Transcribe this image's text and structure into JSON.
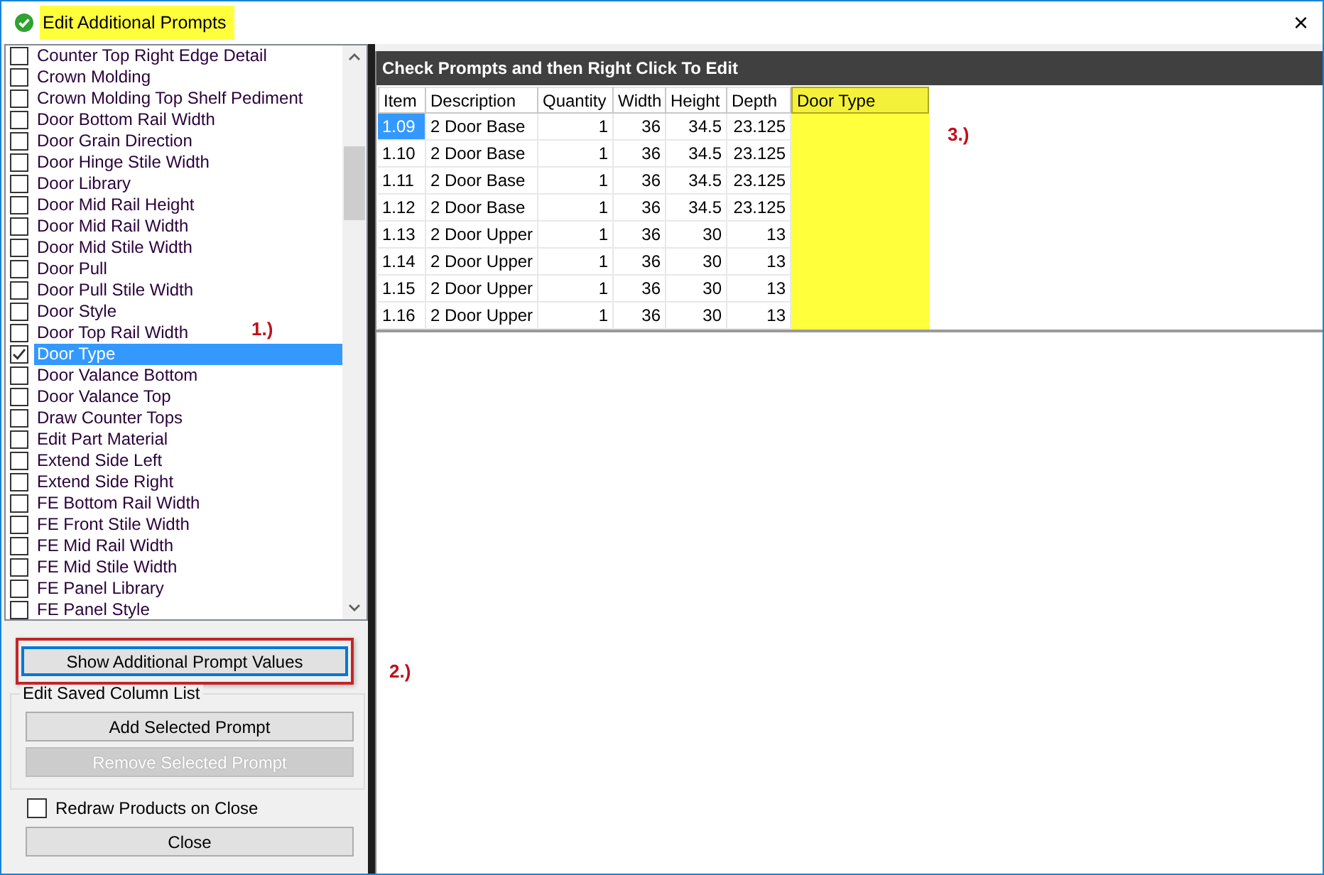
{
  "window": {
    "title": "Edit Additional Prompts",
    "title_highlighted": true,
    "close": "×"
  },
  "prompts": [
    {
      "label": "Counter Top Right Edge Detail",
      "checked": false,
      "selected": false
    },
    {
      "label": "Crown Molding",
      "checked": false,
      "selected": false
    },
    {
      "label": "Crown Molding Top Shelf Pediment",
      "checked": false,
      "selected": false
    },
    {
      "label": "Door Bottom Rail Width",
      "checked": false,
      "selected": false
    },
    {
      "label": "Door Grain Direction",
      "checked": false,
      "selected": false
    },
    {
      "label": "Door Hinge Stile Width",
      "checked": false,
      "selected": false
    },
    {
      "label": "Door Library",
      "checked": false,
      "selected": false
    },
    {
      "label": "Door Mid Rail Height",
      "checked": false,
      "selected": false
    },
    {
      "label": "Door Mid Rail Width",
      "checked": false,
      "selected": false
    },
    {
      "label": "Door Mid Stile Width",
      "checked": false,
      "selected": false
    },
    {
      "label": "Door Pull",
      "checked": false,
      "selected": false
    },
    {
      "label": "Door Pull Stile Width",
      "checked": false,
      "selected": false
    },
    {
      "label": "Door Style",
      "checked": false,
      "selected": false
    },
    {
      "label": "Door Top Rail Width",
      "checked": false,
      "selected": false
    },
    {
      "label": "Door Type",
      "checked": true,
      "selected": true
    },
    {
      "label": "Door Valance Bottom",
      "checked": false,
      "selected": false
    },
    {
      "label": "Door Valance Top",
      "checked": false,
      "selected": false
    },
    {
      "label": "Draw Counter Tops",
      "checked": false,
      "selected": false
    },
    {
      "label": "Edit Part Material",
      "checked": false,
      "selected": false
    },
    {
      "label": "Extend Side Left",
      "checked": false,
      "selected": false
    },
    {
      "label": "Extend Side Right",
      "checked": false,
      "selected": false
    },
    {
      "label": "FE Bottom Rail Width",
      "checked": false,
      "selected": false
    },
    {
      "label": "FE Front Stile Width",
      "checked": false,
      "selected": false
    },
    {
      "label": "FE Mid Rail Width",
      "checked": false,
      "selected": false
    },
    {
      "label": "FE Mid Stile Width",
      "checked": false,
      "selected": false
    },
    {
      "label": "FE Panel Library",
      "checked": false,
      "selected": false
    },
    {
      "label": "FE Panel Style",
      "checked": false,
      "selected": false
    }
  ],
  "show_button": {
    "label": "Show Additional Prompt Values",
    "outlined": true
  },
  "saved_columns": {
    "title": "Edit Saved Column List",
    "buttons": [
      {
        "label": "Add Selected Prompt",
        "disabled": false
      },
      {
        "label": "Remove Selected Prompt",
        "disabled": true
      }
    ]
  },
  "redraw": {
    "label": "Redraw Products on Close",
    "checked": false
  },
  "close_button": "Close",
  "panel_title": "Check Prompts and then Right Click To Edit",
  "table": {
    "columns": [
      {
        "label": "Item",
        "kind": "text",
        "highlighted": false
      },
      {
        "label": "Description",
        "kind": "text",
        "highlighted": false
      },
      {
        "label": "Quantity",
        "kind": "number",
        "highlighted": false
      },
      {
        "label": "Width",
        "kind": "number",
        "highlighted": false
      },
      {
        "label": "Height",
        "kind": "number",
        "highlighted": false
      },
      {
        "label": "Depth",
        "kind": "number",
        "highlighted": false
      },
      {
        "label": "Door Type",
        "kind": "text",
        "highlighted": true
      }
    ],
    "rows": [
      {
        "selected": true,
        "cells": [
          "1.09",
          "2 Door Base",
          "1",
          "36",
          "34.5",
          "23.125",
          ""
        ]
      },
      {
        "selected": false,
        "cells": [
          "1.10",
          "2 Door Base",
          "1",
          "36",
          "34.5",
          "23.125",
          ""
        ]
      },
      {
        "selected": false,
        "cells": [
          "1.11",
          "2 Door Base",
          "1",
          "36",
          "34.5",
          "23.125",
          ""
        ]
      },
      {
        "selected": false,
        "cells": [
          "1.12",
          "2 Door Base",
          "1",
          "36",
          "34.5",
          "23.125",
          ""
        ]
      },
      {
        "selected": false,
        "cells": [
          "1.13",
          "2 Door Upper",
          "1",
          "36",
          "30",
          "13",
          ""
        ]
      },
      {
        "selected": false,
        "cells": [
          "1.14",
          "2 Door Upper",
          "1",
          "36",
          "30",
          "13",
          ""
        ]
      },
      {
        "selected": false,
        "cells": [
          "1.15",
          "2 Door Upper",
          "1",
          "36",
          "30",
          "13",
          ""
        ]
      },
      {
        "selected": false,
        "cells": [
          "1.16",
          "2 Door Upper",
          "1",
          "36",
          "30",
          "13",
          ""
        ]
      }
    ]
  },
  "annotations": [
    {
      "kind": "list",
      "label": "1.)"
    },
    {
      "kind": "button",
      "label": "2.)"
    },
    {
      "kind": "column",
      "label": "3.)"
    }
  ]
}
